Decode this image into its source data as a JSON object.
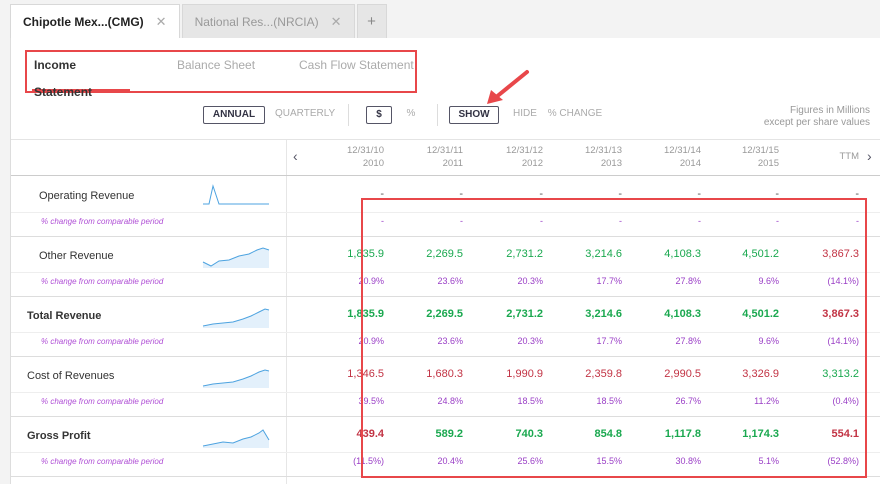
{
  "tabs": [
    {
      "label": "Chipotle Mex...(CMG)",
      "active": true
    },
    {
      "label": "National Res...(NRCIA)",
      "active": false
    }
  ],
  "add_tab_label": "+",
  "close_glyph": "✕",
  "subtabs": [
    "Income Statement",
    "Balance Sheet",
    "Cash Flow Statement"
  ],
  "controls": {
    "annual": "ANNUAL",
    "quarterly": "QUARTERLY",
    "dollar": "$",
    "percent": "%",
    "show": "SHOW",
    "hide": "HIDE",
    "pct_change": "% CHANGE"
  },
  "note": [
    "Figures in Millions",
    "except per share values"
  ],
  "periods": [
    {
      "date": "12/31/10",
      "year": "2010"
    },
    {
      "date": "12/31/11",
      "year": "2011"
    },
    {
      "date": "12/31/12",
      "year": "2012"
    },
    {
      "date": "12/31/13",
      "year": "2013"
    },
    {
      "date": "12/31/14",
      "year": "2014"
    },
    {
      "date": "12/31/15",
      "year": "2015"
    },
    {
      "date": "",
      "year": "TTM"
    }
  ],
  "nav": {
    "prev": "‹",
    "next": "›"
  },
  "pct_label": "% change from comparable period",
  "rows": [
    {
      "label": "Operating Revenue",
      "bold": false,
      "values": [
        "-",
        "-",
        "-",
        "-",
        "-",
        "-",
        "-"
      ],
      "pct": [
        "-",
        "-",
        "-",
        "-",
        "-",
        "-",
        "-"
      ]
    },
    {
      "label": "Other Revenue",
      "bold": false,
      "values": [
        "1,835.9",
        "2,269.5",
        "2,731.2",
        "3,214.6",
        "4,108.3",
        "4,501.2",
        "3,867.3"
      ],
      "pct": [
        "20.9%",
        "23.6%",
        "20.3%",
        "17.7%",
        "27.8%",
        "9.6%",
        "(14.1%)"
      ]
    },
    {
      "label": "Total Revenue",
      "bold": true,
      "values": [
        "1,835.9",
        "2,269.5",
        "2,731.2",
        "3,214.6",
        "4,108.3",
        "4,501.2",
        "3,867.3"
      ],
      "pct": [
        "20.9%",
        "23.6%",
        "20.3%",
        "17.7%",
        "27.8%",
        "9.6%",
        "(14.1%)"
      ]
    },
    {
      "label": "Cost of Revenues",
      "bold": false,
      "values": [
        "1,346.5",
        "1,680.3",
        "1,990.9",
        "2,359.8",
        "2,990.5",
        "3,326.9",
        "3,313.2"
      ],
      "pct": [
        "39.5%",
        "24.8%",
        "18.5%",
        "18.5%",
        "26.7%",
        "11.2%",
        "(0.4%)"
      ]
    },
    {
      "label": "Gross Profit",
      "bold": true,
      "values": [
        "439.4",
        "589.2",
        "740.3",
        "854.8",
        "1,117.8",
        "1,174.3",
        "554.1"
      ],
      "pct": [
        "(11.5%)",
        "20.4%",
        "25.6%",
        "15.5%",
        "30.8%",
        "5.1%",
        "(52.8%)"
      ]
    }
  ],
  "value_colors": [
    [
      "dash",
      "dash",
      "dash",
      "dash",
      "dash",
      "dash",
      "dash"
    ],
    [
      "green",
      "green",
      "green",
      "green",
      "green",
      "green",
      "red"
    ],
    [
      "green",
      "green",
      "green",
      "green",
      "green",
      "green",
      "red"
    ],
    [
      "red",
      "red",
      "red",
      "red",
      "red",
      "red",
      "green"
    ],
    [
      "red",
      "green",
      "green",
      "green",
      "green",
      "green",
      "red"
    ]
  ]
}
